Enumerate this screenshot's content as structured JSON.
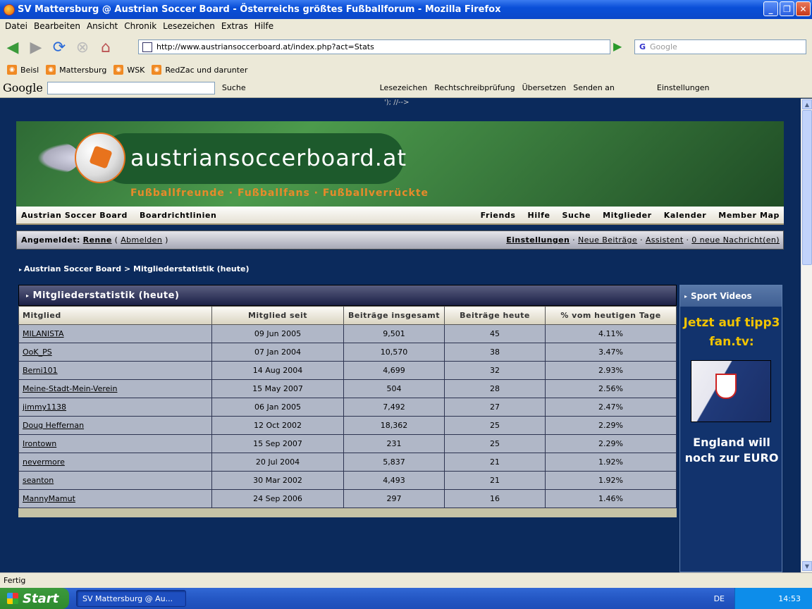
{
  "window": {
    "title": "SV Mattersburg @ Austrian Soccer Board - Österreichs größtes Fußballforum - Mozilla Firefox"
  },
  "menubar": [
    "Datei",
    "Bearbeiten",
    "Ansicht",
    "Chronik",
    "Lesezeichen",
    "Extras",
    "Hilfe"
  ],
  "navbar": {
    "url": "http://www.austriansoccerboard.at/index.php?act=Stats",
    "search_placeholder": "Google"
  },
  "bookmarks": [
    "Beisl",
    "Mattersburg",
    "WSK",
    "RedZac und darunter"
  ],
  "google_toolbar": {
    "logo": "Google",
    "items": [
      "Suche",
      "Lesezeichen",
      "Rechtschreibprüfung",
      "Übersetzen",
      "Senden an",
      "Einstellungen"
    ]
  },
  "page": {
    "html_comment": "'); //-->",
    "banner": {
      "site_name": "austriansoccerboard.at",
      "tagline": "Fußballfreunde · Fußballfans · Fußballverrückte"
    },
    "nav_left": [
      "Austrian Soccer Board",
      "Boardrichtlinien"
    ],
    "nav_right": [
      "Friends",
      "Hilfe",
      "Suche",
      "Mitglieder",
      "Kalender",
      "Member Map"
    ],
    "userbar": {
      "logged_in_label": "Angemeldet:",
      "username": "Renne",
      "paren_open": "(",
      "logout": "Abmelden",
      "paren_close": ")",
      "settings": "Einstellungen",
      "sep": "·",
      "new_posts": "Neue Beiträge",
      "assistant": "Assistent",
      "messages": "0 neue Nachricht(en)"
    },
    "breadcrumb": "Austrian Soccer Board > Mitgliederstatistik (heute)",
    "stats": {
      "title": "Mitgliederstatistik (heute)",
      "columns": [
        "Mitglied",
        "Mitglied seit",
        "Beiträge insgesamt",
        "Beiträge heute",
        "% vom heutigen Tage"
      ],
      "rows": [
        [
          "MILANISTA",
          "09 Jun 2005",
          "9,501",
          "45",
          "4.11%"
        ],
        [
          "OoK_PS",
          "07 Jan 2004",
          "10,570",
          "38",
          "3.47%"
        ],
        [
          "Berni101",
          "14 Aug 2004",
          "4,699",
          "32",
          "2.93%"
        ],
        [
          "Meine-Stadt-Mein-Verein",
          "15 May 2007",
          "504",
          "28",
          "2.56%"
        ],
        [
          "jimmy1138",
          "06 Jan 2005",
          "7,492",
          "27",
          "2.47%"
        ],
        [
          "Doug Heffernan",
          "12 Oct 2002",
          "18,362",
          "25",
          "2.29%"
        ],
        [
          "Irontown",
          "15 Sep 2007",
          "231",
          "25",
          "2.29%"
        ],
        [
          "nevermore",
          "20 Jul 2004",
          "5,837",
          "21",
          "1.92%"
        ],
        [
          "seanton",
          "30 Mar 2002",
          "4,493",
          "21",
          "1.92%"
        ],
        [
          "MannyMamut",
          "24 Sep 2006",
          "297",
          "16",
          "1.46%"
        ]
      ]
    },
    "sidebar": {
      "title": "Sport Videos",
      "ad_top": "Jetzt auf tipp3 fan.tv:",
      "ad_bottom": "England will noch zur EURO"
    }
  },
  "statusbar": "Fertig",
  "taskbar": {
    "start": "Start",
    "task": "SV Mattersburg @ Au...",
    "lang": "DE",
    "clock": "14:53"
  }
}
